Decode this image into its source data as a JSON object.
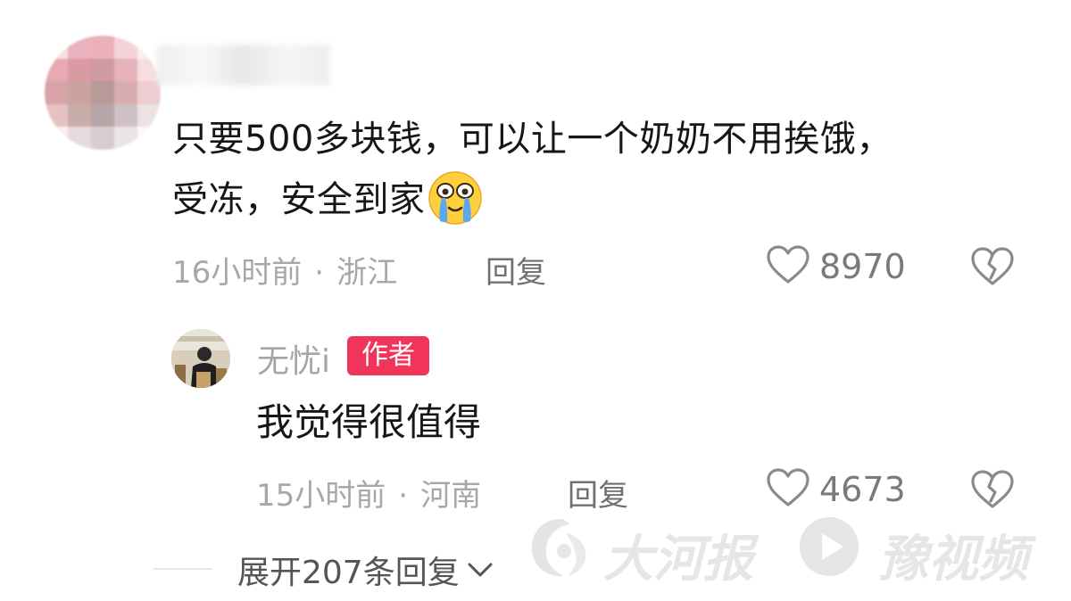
{
  "comment": {
    "text_line1": "只要500多块钱，可以让一个奶奶不用挨饿，",
    "text_line2": "受冻，安全到家",
    "emoji": "crying-face-emoji",
    "time": "16小时前",
    "separator": "·",
    "location": "浙江",
    "reply_label": "回复",
    "likes": "8970"
  },
  "reply": {
    "author_name": "无忧i",
    "author_badge": "作者",
    "text": "我觉得很值得",
    "time": "15小时前",
    "separator": "·",
    "location": "河南",
    "reply_label": "回复",
    "likes": "4673"
  },
  "expand_replies": {
    "label": "展开207条回复"
  },
  "watermarks": {
    "brand1": "大河报",
    "brand2": "豫视频"
  },
  "colors": {
    "author_badge": "#f0345a",
    "meta_text": "#a7a7a7",
    "body_text": "#161616"
  }
}
